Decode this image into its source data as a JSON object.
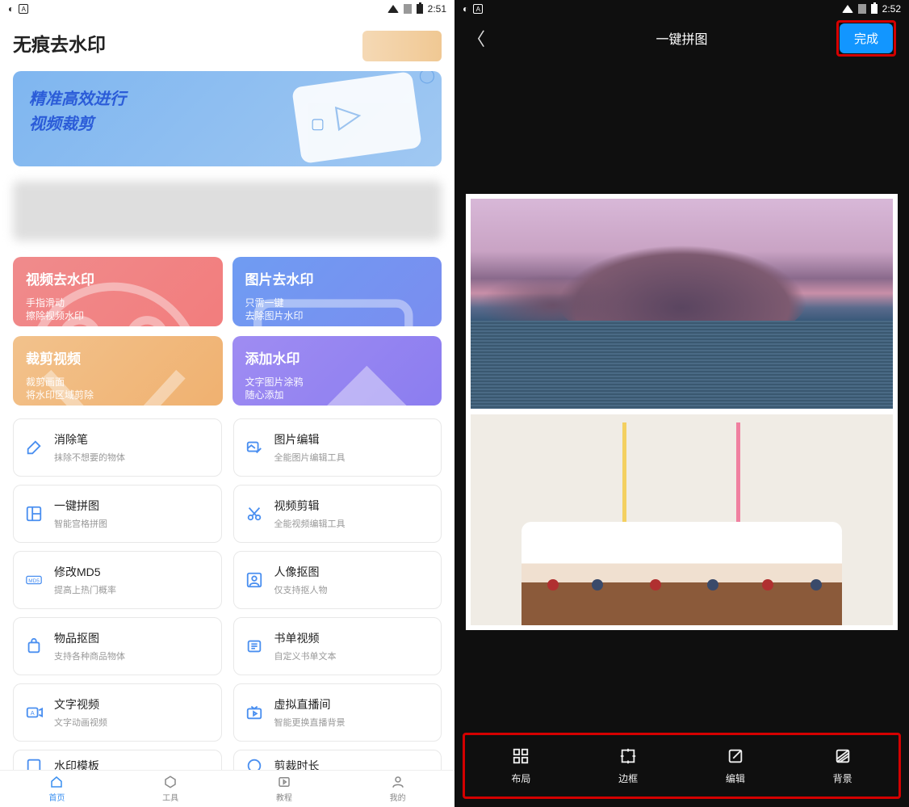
{
  "status_left": {
    "time": "2:51"
  },
  "status_right": {
    "time": "2:52"
  },
  "left": {
    "title": "无痕去水印",
    "banner": {
      "line1": "精准高效进行",
      "line2": "视频裁剪"
    },
    "big": [
      {
        "t": "视频去水印",
        "s": "手指滑动\n擦除视频水印"
      },
      {
        "t": "图片去水印",
        "s": "只需一键\n去除图片水印"
      },
      {
        "t": "裁剪视频",
        "s": "裁剪画面\n将水印区域剪除"
      },
      {
        "t": "添加水印",
        "s": "文字图片涂鸦\n随心添加"
      }
    ],
    "items": [
      {
        "t": "消除笔",
        "s": "抹除不想要的物体"
      },
      {
        "t": "图片编辑",
        "s": "全能图片编辑工具"
      },
      {
        "t": "一键拼图",
        "s": "智能宫格拼图"
      },
      {
        "t": "视频剪辑",
        "s": "全能视频编辑工具"
      },
      {
        "t": "修改MD5",
        "s": "提高上热门概率"
      },
      {
        "t": "人像抠图",
        "s": "仅支持抠人物"
      },
      {
        "t": "物品抠图",
        "s": "支持各种商品物体"
      },
      {
        "t": "书单视频",
        "s": "自定义书单文本"
      },
      {
        "t": "文字视频",
        "s": "文字动画视频"
      },
      {
        "t": "虚拟直播间",
        "s": "智能更换直播背景"
      },
      {
        "t": "水印模板",
        "s": ""
      },
      {
        "t": "剪裁时长",
        "s": ""
      }
    ],
    "nav": [
      "首页",
      "工具",
      "教程",
      "我的"
    ]
  },
  "right": {
    "title": "一键拼图",
    "done": "完成",
    "tools": [
      "布局",
      "边框",
      "编辑",
      "背景"
    ]
  }
}
